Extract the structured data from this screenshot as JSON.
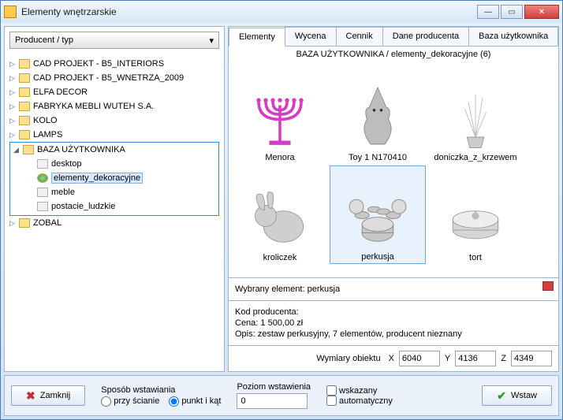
{
  "window": {
    "title": "Elementy wnętrzarskie"
  },
  "dropdown": {
    "label": "Producent / typ"
  },
  "tree": {
    "roots": [
      {
        "label": "CAD PROJEKT - B5_INTERIORS"
      },
      {
        "label": "CAD PROJEKT - B5_WNETRZA_2009"
      },
      {
        "label": "ELFA DECOR"
      },
      {
        "label": "FABRYKA MEBLI WUTEH S.A."
      },
      {
        "label": "KOLO"
      },
      {
        "label": "LAMPS"
      }
    ],
    "expanded": {
      "label": "BAZA UŻYTKOWNIKA",
      "children": [
        {
          "label": "desktop",
          "icon": "page"
        },
        {
          "label": "elementy_dekoracyjne",
          "icon": "special",
          "selected": true
        },
        {
          "label": "meble",
          "icon": "page"
        },
        {
          "label": "postacie_ludzkie",
          "icon": "page"
        }
      ]
    },
    "after": [
      {
        "label": "ZOBAL"
      }
    ]
  },
  "tabs": {
    "items": [
      "Elementy",
      "Wycena",
      "Cennik",
      "Dane producenta",
      "Baza użytkownika"
    ],
    "active": 0
  },
  "path": "BAZA UŻYTKOWNIKA / elementy_dekoracyjne (6)",
  "thumbs": [
    {
      "name": "Menora"
    },
    {
      "name": "Toy 1 N170410"
    },
    {
      "name": "doniczka_z_krzewem"
    },
    {
      "name": "kroliczek"
    },
    {
      "name": "perkusja",
      "selected": true
    },
    {
      "name": "tort"
    }
  ],
  "details": {
    "selected_label": "Wybrany element: perkusja",
    "code_label": "Kod producenta:",
    "price_label": "Cena: 1 500,00 zł",
    "desc_label": "Opis: zestaw perkusyjny, 7 elementów, producent nieznany"
  },
  "dims": {
    "label": "Wymiary obiektu",
    "x_label": "X",
    "x_val": "6040",
    "y_label": "Y",
    "y_val": "4136",
    "z_label": "Z",
    "z_val": "4349"
  },
  "bottom": {
    "close": "Zamknij",
    "insert": "Wstaw",
    "mode_label": "Sposób wstawiania",
    "mode_wall": "przy ścianie",
    "mode_point": "punkt i kąt",
    "level_label": "Poziom wstawienia",
    "level_val": "0",
    "chk_indicated": "wskazany",
    "chk_auto": "automatyczny"
  }
}
